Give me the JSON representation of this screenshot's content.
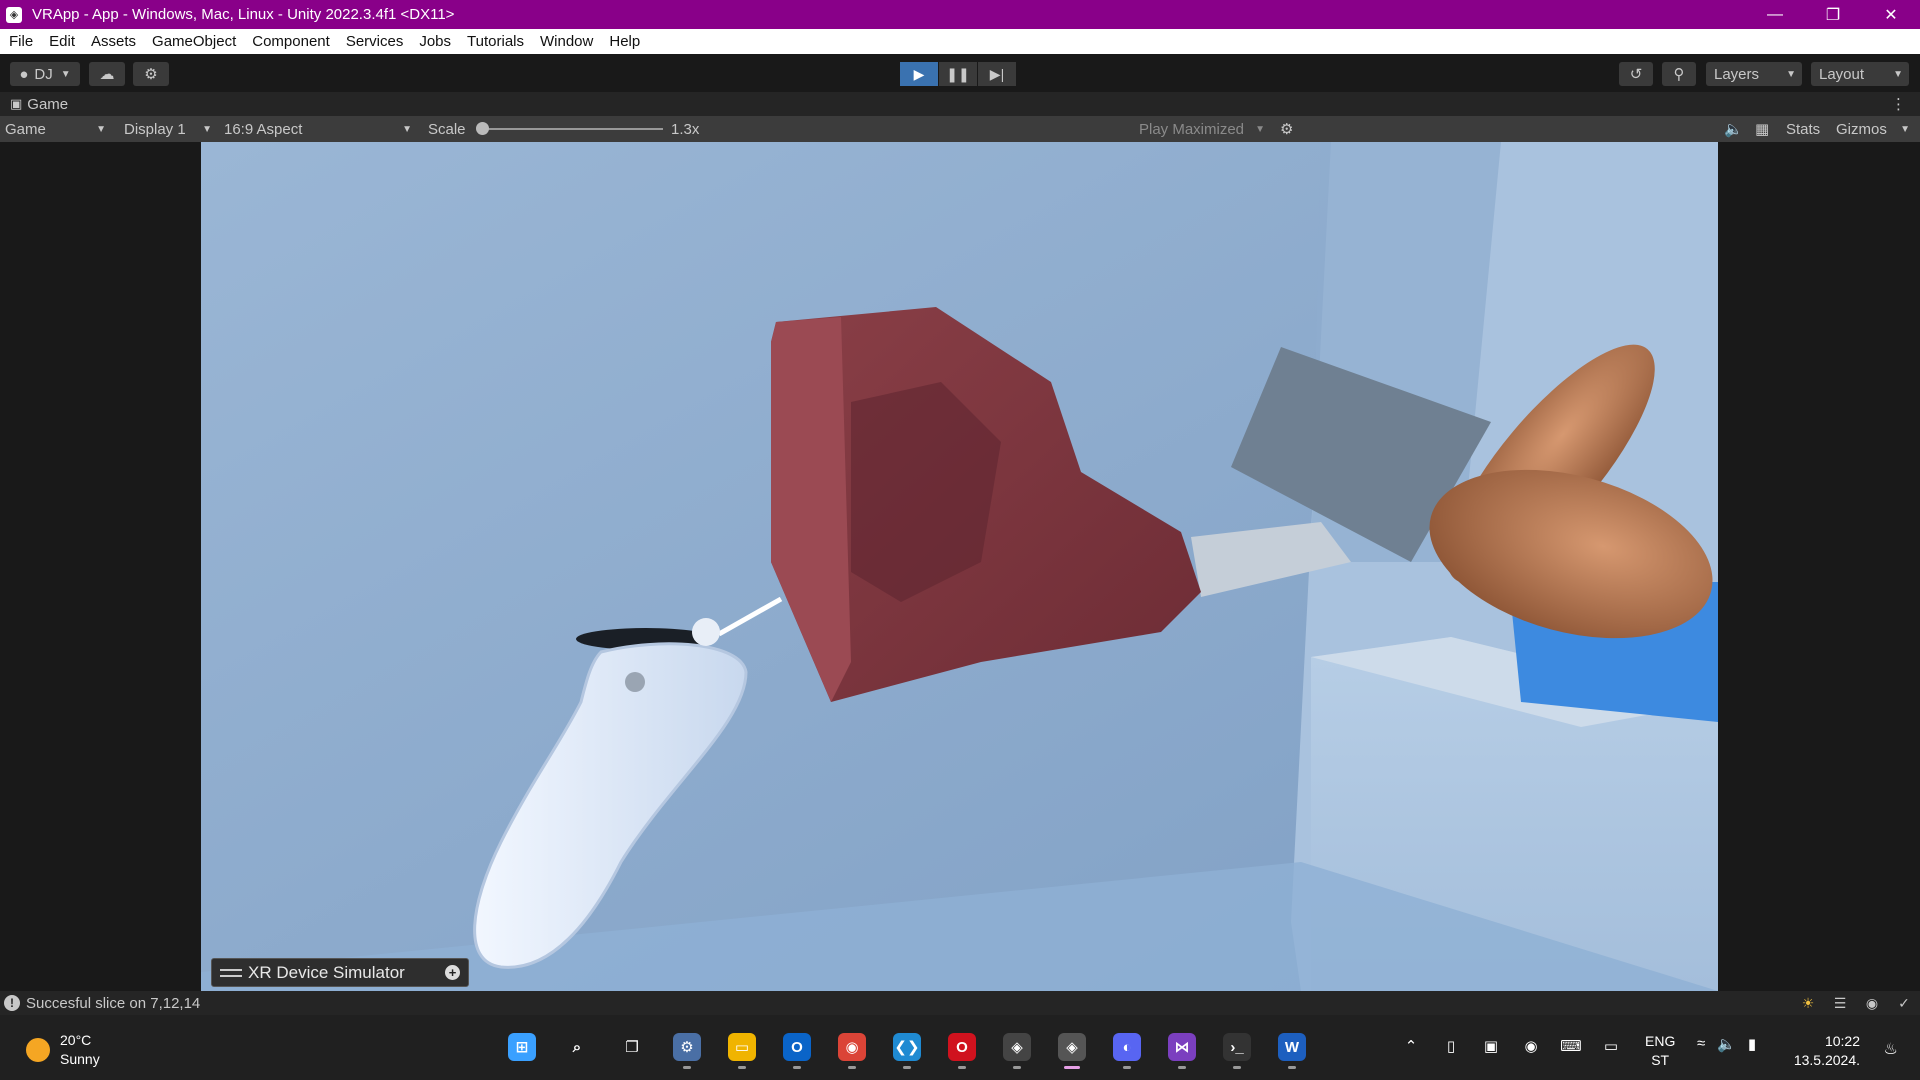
{
  "window": {
    "title": "VRApp - App - Windows, Mac, Linux - Unity 2022.3.4f1 <DX11>",
    "minimize_icon": "minimize-icon",
    "restore_icon": "restore-icon",
    "close_icon": "close-icon"
  },
  "menu": {
    "items": [
      "File",
      "Edit",
      "Assets",
      "GameObject",
      "Component",
      "Services",
      "Jobs",
      "Tutorials",
      "Window",
      "Help"
    ]
  },
  "toolbar": {
    "account_label": "DJ",
    "layers_label": "Layers",
    "layout_label": "Layout",
    "play_active": true,
    "accent_color": "#3a72b0"
  },
  "tab": {
    "label": "Game"
  },
  "gamebar": {
    "mode": "Game",
    "display": "Display 1",
    "aspect": "16:9 Aspect",
    "scale_label": "Scale",
    "scale_value": "1.3x",
    "play_maximized": "Play Maximized",
    "stats": "Stats",
    "gizmos": "Gizmos"
  },
  "scene": {
    "xr_panel_label": "XR Device Simulator"
  },
  "status": {
    "message": "Succesful slice on 7,12,14"
  },
  "taskbar": {
    "temperature": "20°C",
    "condition": "Sunny",
    "apps": [
      {
        "name": "windows-start",
        "glyph": "⊞",
        "color": "#3aa0ff"
      },
      {
        "name": "search",
        "glyph": "⌕",
        "color": "transparent"
      },
      {
        "name": "task-view",
        "glyph": "❐",
        "color": "transparent"
      },
      {
        "name": "settings",
        "glyph": "⚙",
        "color": "#4a6fa5"
      },
      {
        "name": "file-explorer",
        "glyph": "▭",
        "color": "#f0b400"
      },
      {
        "name": "outlook",
        "glyph": "O",
        "color": "#0a64c8"
      },
      {
        "name": "chrome",
        "glyph": "◉",
        "color": "#db4437"
      },
      {
        "name": "vscode",
        "glyph": "❮❯",
        "color": "#1f8ad2"
      },
      {
        "name": "opera",
        "glyph": "O",
        "color": "#d0121e"
      },
      {
        "name": "unity-hub",
        "glyph": "◈",
        "color": "#444"
      },
      {
        "name": "unity",
        "glyph": "◈",
        "color": "#555"
      },
      {
        "name": "discord",
        "glyph": "◐",
        "color": "#5865f2"
      },
      {
        "name": "visual-studio",
        "glyph": "⋈",
        "color": "#7b3fbf"
      },
      {
        "name": "terminal",
        "glyph": "›_",
        "color": "#333"
      },
      {
        "name": "word",
        "glyph": "W",
        "color": "#1d5fbf"
      }
    ],
    "language": "ENG",
    "language_sub": "ST",
    "time": "10:22",
    "date": "13.5.2024."
  }
}
